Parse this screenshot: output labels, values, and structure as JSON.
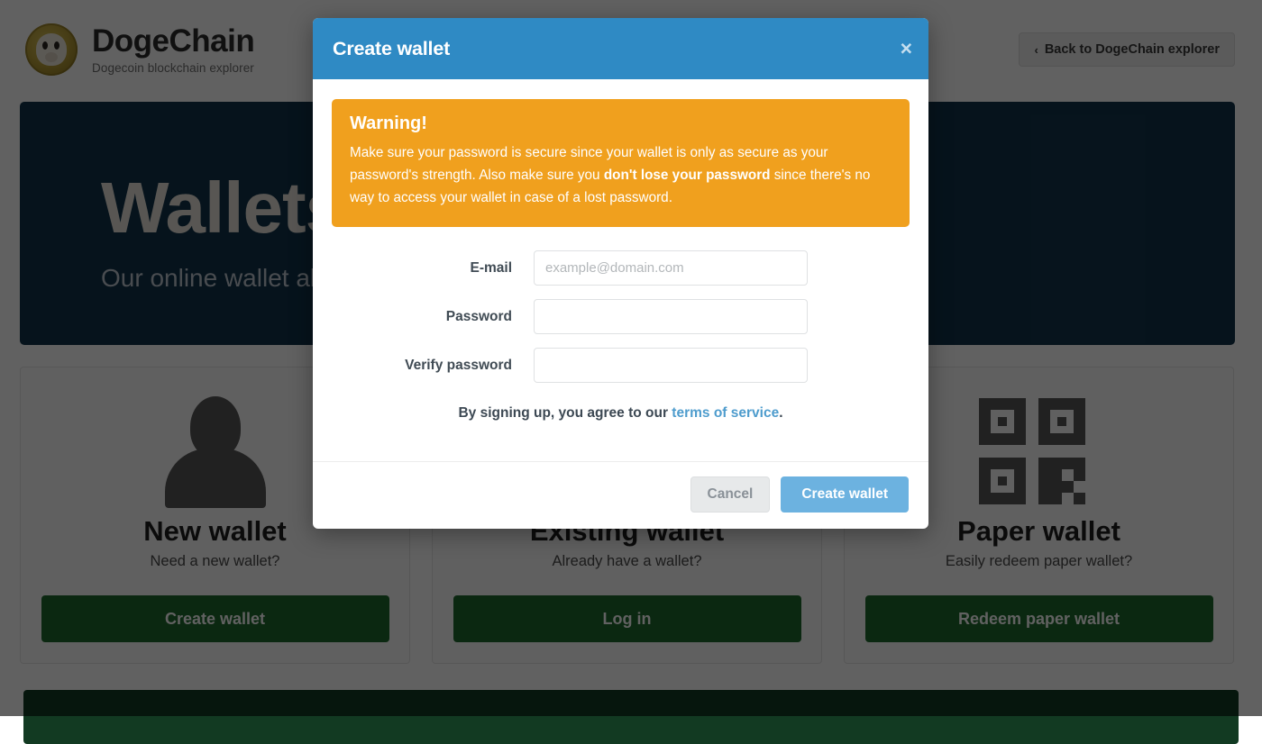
{
  "header": {
    "brand_title": "DogeChain",
    "brand_subtitle": "Dogecoin blockchain explorer",
    "back_chevron": "‹",
    "back_label": "Back to DogeChain explorer"
  },
  "hero": {
    "title": "Wallets",
    "subtitle": "Our online wallet allows"
  },
  "cards": [
    {
      "icon": "person-icon",
      "title": "New wallet",
      "subtitle": "Need a new wallet?",
      "button": "Create wallet"
    },
    {
      "icon": "person-icon",
      "title": "Existing wallet",
      "subtitle": "Already have a wallet?",
      "button": "Log in"
    },
    {
      "icon": "qr-icon",
      "title": "Paper wallet",
      "subtitle": "Easily redeem paper wallet?",
      "button": "Redeem paper wallet"
    }
  ],
  "modal": {
    "title": "Create wallet",
    "close_glyph": "×",
    "warning": {
      "title": "Warning!",
      "text_before": "Make sure your password is secure since your wallet is only as secure as your password's strength. Also make sure you ",
      "text_bold": "don't lose your password",
      "text_after": " since there's no way to access your wallet in case of a lost password."
    },
    "fields": [
      {
        "label": "E-mail",
        "placeholder": "example@domain.com",
        "value": "",
        "type": "text"
      },
      {
        "label": "Password",
        "placeholder": "",
        "value": "",
        "type": "password"
      },
      {
        "label": "Verify password",
        "placeholder": "",
        "value": "",
        "type": "password"
      }
    ],
    "tos_text": "By signing up, you agree to our ",
    "tos_link": "terms of service",
    "tos_period": ".",
    "cancel_label": "Cancel",
    "submit_label": "Create wallet"
  },
  "colors": {
    "modal_header": "#2f8ac4",
    "warning_bg": "#f0a01e",
    "hero_bg": "#12344b",
    "green_button": "#1d6b2d",
    "primary_button": "#6cb2e0",
    "link": "#4e9ccd"
  }
}
